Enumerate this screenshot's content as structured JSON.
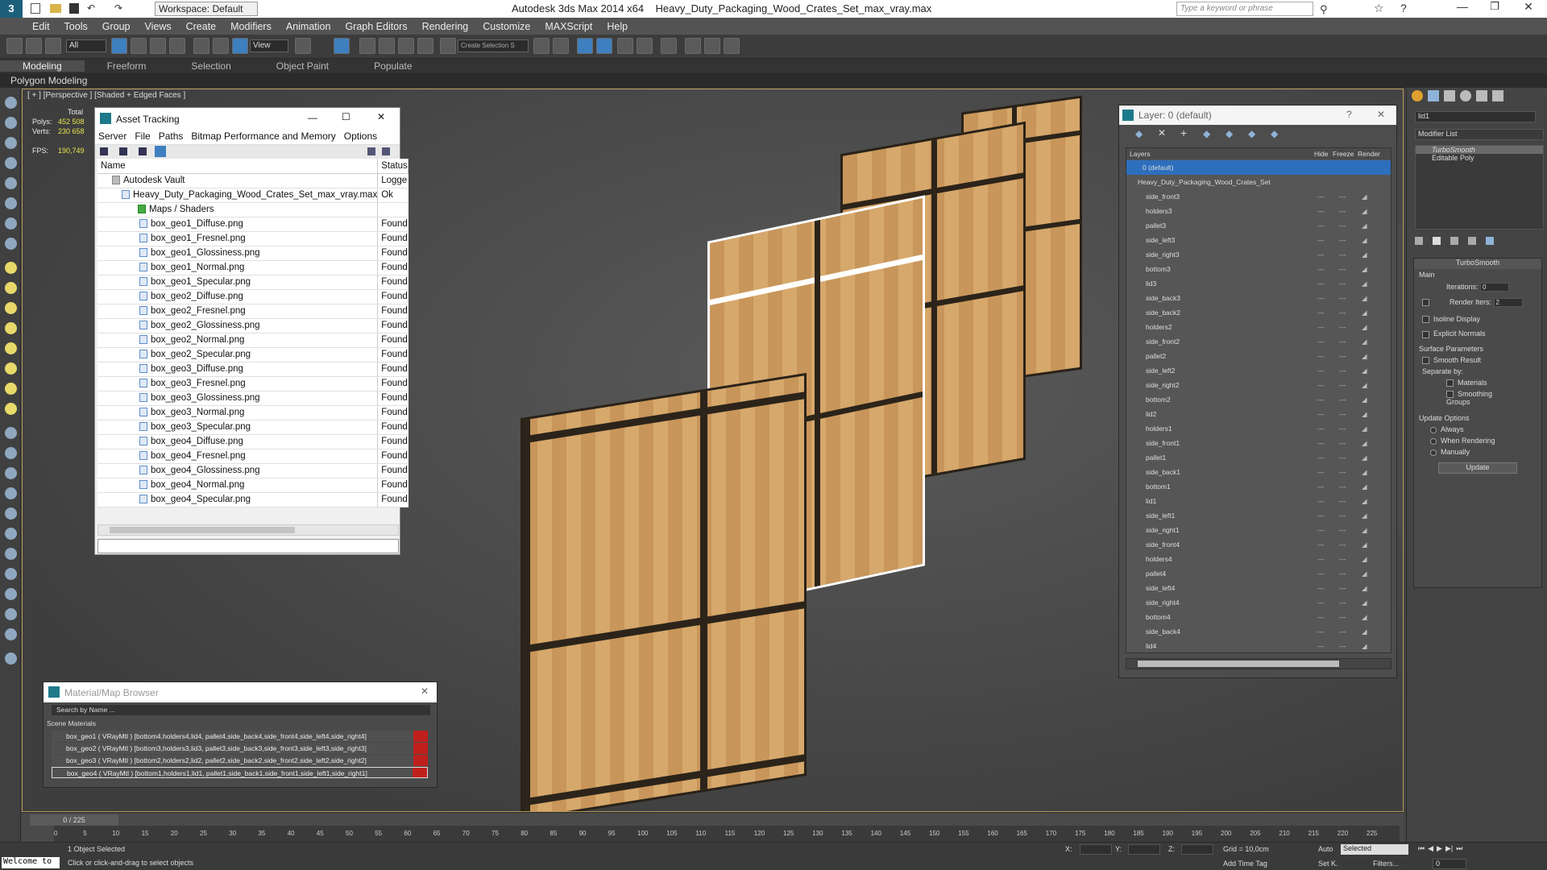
{
  "titlebar": {
    "app": "Autodesk 3ds Max  2014 x64",
    "file": "Heavy_Duty_Packaging_Wood_Crates_Set_max_vray.max",
    "workspace": "Workspace: Default",
    "search_placeholder": "Type a keyword or phrase"
  },
  "menu": [
    "Edit",
    "Tools",
    "Group",
    "Views",
    "Create",
    "Modifiers",
    "Animation",
    "Graph Editors",
    "Rendering",
    "Customize",
    "MAXScript",
    "Help"
  ],
  "toolbar": {
    "filter": "All",
    "refcoord": "View",
    "selset": "Create Selection S"
  },
  "ribbon": {
    "tabs": [
      "Modeling",
      "Freeform",
      "Selection",
      "Object Paint",
      "Populate"
    ],
    "sub": "Polygon Modeling"
  },
  "viewport": {
    "label": "[ + ] [Perspective ] [Shaded + Edged Faces ]",
    "stats": {
      "total": "Total",
      "polys_label": "Polys:",
      "polys": "452 508",
      "verts_label": "Verts:",
      "verts": "230 658",
      "fps_label": "FPS:",
      "fps": "190,749"
    }
  },
  "asset": {
    "title": "Asset Tracking",
    "menu": [
      "Server",
      "File",
      "Paths",
      "Bitmap Performance and Memory",
      "Options"
    ],
    "col_name": "Name",
    "col_status": "Status",
    "vault": {
      "name": "Autodesk Vault",
      "status": "Logge"
    },
    "file": {
      "name": "Heavy_Duty_Packaging_Wood_Crates_Set_max_vray.max",
      "status": "Ok"
    },
    "maps": "Maps / Shaders",
    "items": [
      {
        "name": "box_geo1_Diffuse.png",
        "status": "Found"
      },
      {
        "name": "box_geo1_Fresnel.png",
        "status": "Found"
      },
      {
        "name": "box_geo1_Glossiness.png",
        "status": "Found"
      },
      {
        "name": "box_geo1_Normal.png",
        "status": "Found"
      },
      {
        "name": "box_geo1_Specular.png",
        "status": "Found"
      },
      {
        "name": "box_geo2_Diffuse.png",
        "status": "Found"
      },
      {
        "name": "box_geo2_Fresnel.png",
        "status": "Found"
      },
      {
        "name": "box_geo2_Glossiness.png",
        "status": "Found"
      },
      {
        "name": "box_geo2_Normal.png",
        "status": "Found"
      },
      {
        "name": "box_geo2_Specular.png",
        "status": "Found"
      },
      {
        "name": "box_geo3_Diffuse.png",
        "status": "Found"
      },
      {
        "name": "box_geo3_Fresnel.png",
        "status": "Found"
      },
      {
        "name": "box_geo3_Glossiness.png",
        "status": "Found"
      },
      {
        "name": "box_geo3_Normal.png",
        "status": "Found"
      },
      {
        "name": "box_geo3_Specular.png",
        "status": "Found"
      },
      {
        "name": "box_geo4_Diffuse.png",
        "status": "Found"
      },
      {
        "name": "box_geo4_Fresnel.png",
        "status": "Found"
      },
      {
        "name": "box_geo4_Glossiness.png",
        "status": "Found"
      },
      {
        "name": "box_geo4_Normal.png",
        "status": "Found"
      },
      {
        "name": "box_geo4_Specular.png",
        "status": "Found"
      }
    ]
  },
  "layer": {
    "title": "Layer: 0 (default)",
    "headers": {
      "layers": "Layers",
      "hide": "Hide",
      "freeze": "Freeze",
      "render": "Render"
    },
    "default": "0 (default)",
    "group": "Heavy_Duty_Packaging_Wood_Crates_Set",
    "items": [
      "side_front3",
      "holders3",
      "pallet3",
      "side_left3",
      "side_right3",
      "bottom3",
      "lid3",
      "side_back3",
      "side_back2",
      "holders2",
      "side_front2",
      "pallet2",
      "side_left2",
      "side_right2",
      "bottom2",
      "lid2",
      "holders1",
      "side_front1",
      "pallet1",
      "side_back1",
      "bottom1",
      "lid1",
      "side_left1",
      "side_right1",
      "side_front4",
      "holders4",
      "pallet4",
      "side_left4",
      "side_right4",
      "bottom4",
      "side_back4",
      "lid4"
    ]
  },
  "material_browser": {
    "title": "Material/Map Browser",
    "search": "Search by Name ...",
    "section": "Scene Materials",
    "items": [
      "box_geo1  ( VRayMtl )  [bottom4,holders4,lid4, pallet4,side_back4,side_front4,side_left4,side_right4]",
      "box_geo2  ( VRayMtl )  [bottom3,holders3,lid3, pallet3,side_back3,side_front3,side_left3,side_right3]",
      "box_geo3  ( VRayMtl )  [bottom2,holders2,lid2, pallet2,side_back2,side_front2,side_left2,side_right2]",
      "box_geo4  ( VRayMtl )  [bottom1,holders1,lid1, pallet1,side_back1,side_front1,side_left1,side_right1]"
    ]
  },
  "modifier": {
    "name": "lid1",
    "list_label": "Modifier List",
    "stack": [
      "TurboSmooth",
      "Editable Poly"
    ],
    "rollout": "TurboSmooth",
    "main": "Main",
    "iterations_label": "Iterations:",
    "iterations": "0",
    "render_iters_label": "Render Iters:",
    "render_iters": "2",
    "isoline": "Isoline Display",
    "explicit": "Explicit Normals",
    "surface": "Surface Parameters",
    "smooth": "Smooth Result",
    "separate": "Separate by:",
    "materials": "Materials",
    "smoothing": "Smoothing Groups",
    "update_opts": "Update Options",
    "always": "Always",
    "when_rendering": "When Rendering",
    "manually": "Manually",
    "update_btn": "Update"
  },
  "timeline": {
    "frame": "0 / 225",
    "ticks": [
      "0",
      "5",
      "10",
      "15",
      "20",
      "25",
      "30",
      "35",
      "40",
      "45",
      "50",
      "55",
      "60",
      "65",
      "70",
      "75",
      "80",
      "85",
      "90",
      "95",
      "100",
      "105",
      "110",
      "115",
      "120",
      "125",
      "130",
      "135",
      "140",
      "145",
      "150",
      "155",
      "160",
      "165",
      "170",
      "175",
      "180",
      "185",
      "190",
      "195",
      "200",
      "205",
      "210",
      "215",
      "220",
      "225"
    ]
  },
  "status": {
    "welcome": "Welcome to",
    "selected": "1 Object Selected",
    "hint": "Click or click-and-drag to select objects",
    "x": "X:",
    "y": "Y:",
    "z": "Z:",
    "grid": "Grid = 10,0cm",
    "addtime": "Add Time Tag",
    "auto": "Auto",
    "selected_dd": "Selected",
    "setk": "Set K.",
    "filters": "Filters...",
    "frame": "0"
  }
}
